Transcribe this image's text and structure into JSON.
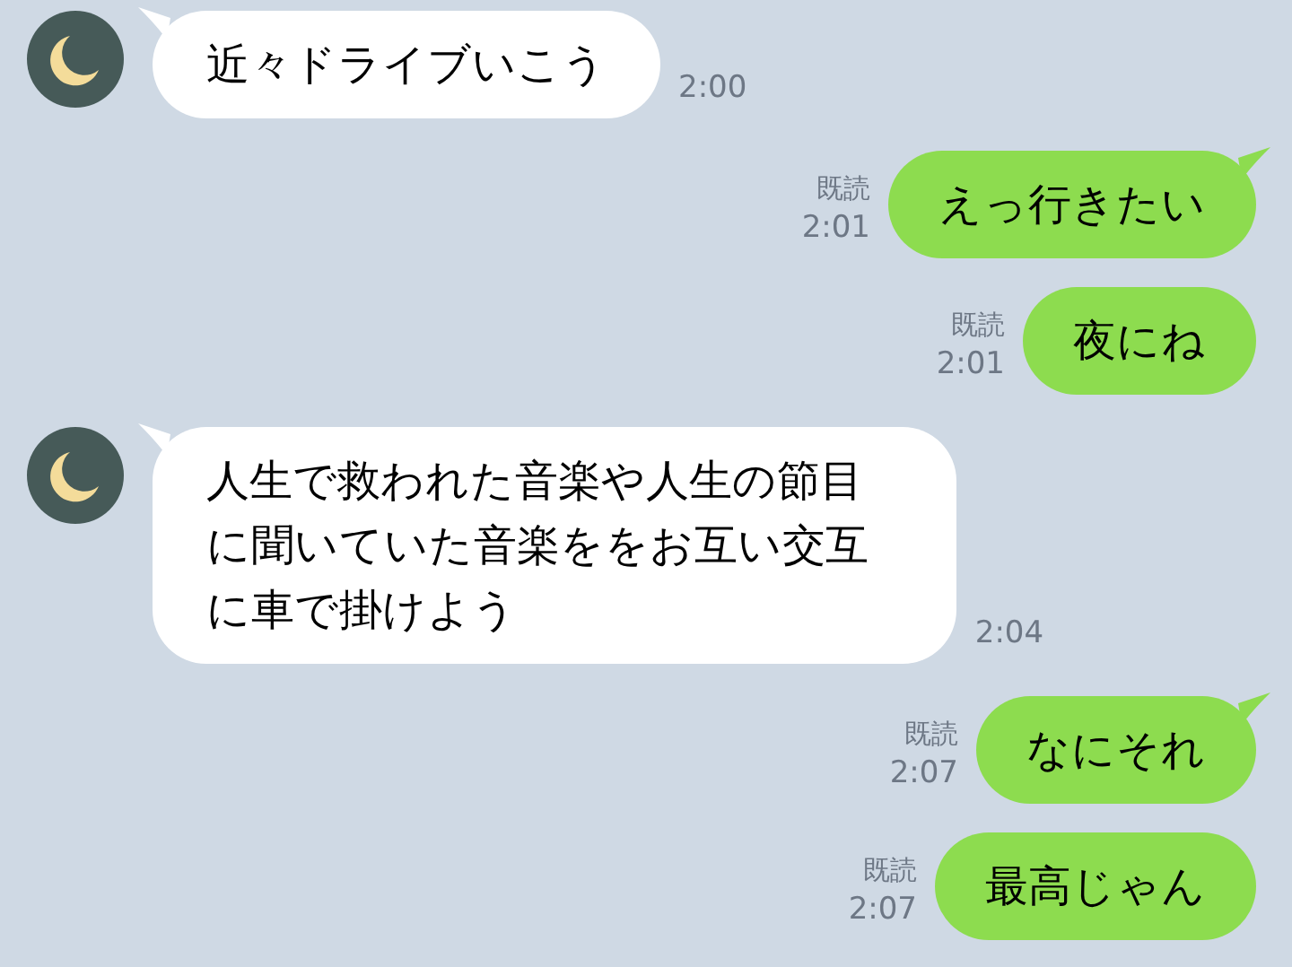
{
  "messages": [
    {
      "kind": "received",
      "tail": true,
      "text": "近々ドライブいこう",
      "time": "2:00"
    },
    {
      "kind": "sent",
      "tail": true,
      "read_label": "既読",
      "text": "えっ行きたい",
      "time": "2:01"
    },
    {
      "kind": "sent",
      "tail": false,
      "read_label": "既読",
      "text": "夜にね",
      "time": "2:01"
    },
    {
      "kind": "received",
      "tail": true,
      "text": "人生で救われた音楽や人生の節目に聞いていた音楽ををお互い交互に車で掛けよう",
      "time": "2:04"
    },
    {
      "kind": "sent",
      "tail": true,
      "read_label": "既読",
      "text": "なにそれ",
      "time": "2:07"
    },
    {
      "kind": "sent",
      "tail": false,
      "read_label": "既読",
      "text": "最高じゃん",
      "time": "2:07"
    }
  ]
}
